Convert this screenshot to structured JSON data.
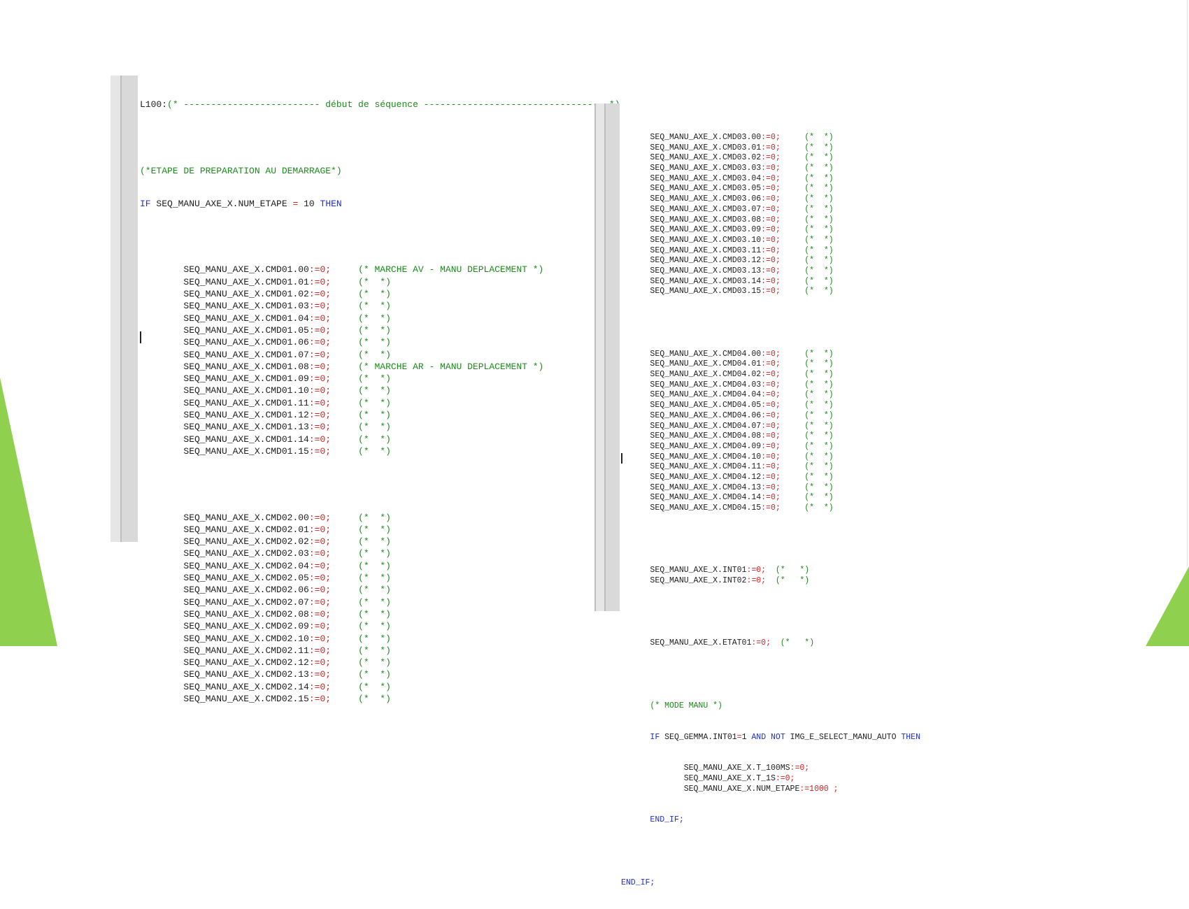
{
  "colors": {
    "background": "#ffffff",
    "keyword": "#1f2fd0",
    "operator": "#d42020",
    "comment": "#1e8a1e",
    "slide_accent": "#8fd14f"
  },
  "left_panel": {
    "header": {
      "label": "L100:",
      "comment": "(* ------------------------- début de séquence --------------------------------- *)"
    },
    "step_comment": "(*ETAPE DE PREPARATION AU DEMARRAGE*)",
    "if_line": {
      "kw_if": "IF",
      "condition": "SEQ_MANU_AXE_X.NUM_ETAPE",
      "op": "=",
      "value": "10",
      "kw_then": "THEN"
    },
    "group1": [
      {
        "var": "SEQ_MANU_AXE_X.CMD01.00",
        "assign": ":=0;",
        "comment": "(* MARCHE AV - MANU DEPLACEMENT *)"
      },
      {
        "var": "SEQ_MANU_AXE_X.CMD01.01",
        "assign": ":=0;",
        "comment": "(*  *)"
      },
      {
        "var": "SEQ_MANU_AXE_X.CMD01.02",
        "assign": ":=0;",
        "comment": "(*  *)"
      },
      {
        "var": "SEQ_MANU_AXE_X.CMD01.03",
        "assign": ":=0;",
        "comment": "(*  *)"
      },
      {
        "var": "SEQ_MANU_AXE_X.CMD01.04",
        "assign": ":=0;",
        "comment": "(*  *)"
      },
      {
        "var": "SEQ_MANU_AXE_X.CMD01.05",
        "assign": ":=0;",
        "comment": "(*  *)"
      },
      {
        "var": "SEQ_MANU_AXE_X.CMD01.06",
        "assign": ":=0;",
        "comment": "(*  *)"
      },
      {
        "var": "SEQ_MANU_AXE_X.CMD01.07",
        "assign": ":=0;",
        "comment": "(*  *)"
      },
      {
        "var": "SEQ_MANU_AXE_X.CMD01.08",
        "assign": ":=0;",
        "comment": "(* MARCHE AR - MANU DEPLACEMENT *)"
      },
      {
        "var": "SEQ_MANU_AXE_X.CMD01.09",
        "assign": ":=0;",
        "comment": "(*  *)"
      },
      {
        "var": "SEQ_MANU_AXE_X.CMD01.10",
        "assign": ":=0;",
        "comment": "(*  *)"
      },
      {
        "var": "SEQ_MANU_AXE_X.CMD01.11",
        "assign": ":=0;",
        "comment": "(*  *)"
      },
      {
        "var": "SEQ_MANU_AXE_X.CMD01.12",
        "assign": ":=0;",
        "comment": "(*  *)"
      },
      {
        "var": "SEQ_MANU_AXE_X.CMD01.13",
        "assign": ":=0;",
        "comment": "(*  *)"
      },
      {
        "var": "SEQ_MANU_AXE_X.CMD01.14",
        "assign": ":=0;",
        "comment": "(*  *)"
      },
      {
        "var": "SEQ_MANU_AXE_X.CMD01.15",
        "assign": ":=0;",
        "comment": "(*  *)"
      }
    ],
    "group2": [
      {
        "var": "SEQ_MANU_AXE_X.CMD02.00",
        "assign": ":=0;",
        "comment": "(*  *)"
      },
      {
        "var": "SEQ_MANU_AXE_X.CMD02.01",
        "assign": ":=0;",
        "comment": "(*  *)"
      },
      {
        "var": "SEQ_MANU_AXE_X.CMD02.02",
        "assign": ":=0;",
        "comment": "(*  *)"
      },
      {
        "var": "SEQ_MANU_AXE_X.CMD02.03",
        "assign": ":=0;",
        "comment": "(*  *)"
      },
      {
        "var": "SEQ_MANU_AXE_X.CMD02.04",
        "assign": ":=0;",
        "comment": "(*  *)"
      },
      {
        "var": "SEQ_MANU_AXE_X.CMD02.05",
        "assign": ":=0;",
        "comment": "(*  *)"
      },
      {
        "var": "SEQ_MANU_AXE_X.CMD02.06",
        "assign": ":=0;",
        "comment": "(*  *)"
      },
      {
        "var": "SEQ_MANU_AXE_X.CMD02.07",
        "assign": ":=0;",
        "comment": "(*  *)"
      },
      {
        "var": "SEQ_MANU_AXE_X.CMD02.08",
        "assign": ":=0;",
        "comment": "(*  *)"
      },
      {
        "var": "SEQ_MANU_AXE_X.CMD02.09",
        "assign": ":=0;",
        "comment": "(*  *)"
      },
      {
        "var": "SEQ_MANU_AXE_X.CMD02.10",
        "assign": ":=0;",
        "comment": "(*  *)"
      },
      {
        "var": "SEQ_MANU_AXE_X.CMD02.11",
        "assign": ":=0;",
        "comment": "(*  *)"
      },
      {
        "var": "SEQ_MANU_AXE_X.CMD02.12",
        "assign": ":=0;",
        "comment": "(*  *)"
      },
      {
        "var": "SEQ_MANU_AXE_X.CMD02.13",
        "assign": ":=0;",
        "comment": "(*  *)"
      },
      {
        "var": "SEQ_MANU_AXE_X.CMD02.14",
        "assign": ":=0;",
        "comment": "(*  *)"
      },
      {
        "var": "SEQ_MANU_AXE_X.CMD02.15",
        "assign": ":=0;",
        "comment": "(*  *)"
      }
    ]
  },
  "right_panel": {
    "group3": [
      {
        "var": "SEQ_MANU_AXE_X.CMD03.00",
        "assign": ":=0;",
        "comment": "(*  *)"
      },
      {
        "var": "SEQ_MANU_AXE_X.CMD03.01",
        "assign": ":=0;",
        "comment": "(*  *)"
      },
      {
        "var": "SEQ_MANU_AXE_X.CMD03.02",
        "assign": ":=0;",
        "comment": "(*  *)"
      },
      {
        "var": "SEQ_MANU_AXE_X.CMD03.03",
        "assign": ":=0;",
        "comment": "(*  *)"
      },
      {
        "var": "SEQ_MANU_AXE_X.CMD03.04",
        "assign": ":=0;",
        "comment": "(*  *)"
      },
      {
        "var": "SEQ_MANU_AXE_X.CMD03.05",
        "assign": ":=0;",
        "comment": "(*  *)"
      },
      {
        "var": "SEQ_MANU_AXE_X.CMD03.06",
        "assign": ":=0;",
        "comment": "(*  *)"
      },
      {
        "var": "SEQ_MANU_AXE_X.CMD03.07",
        "assign": ":=0;",
        "comment": "(*  *)"
      },
      {
        "var": "SEQ_MANU_AXE_X.CMD03.08",
        "assign": ":=0;",
        "comment": "(*  *)"
      },
      {
        "var": "SEQ_MANU_AXE_X.CMD03.09",
        "assign": ":=0;",
        "comment": "(*  *)"
      },
      {
        "var": "SEQ_MANU_AXE_X.CMD03.10",
        "assign": ":=0;",
        "comment": "(*  *)"
      },
      {
        "var": "SEQ_MANU_AXE_X.CMD03.11",
        "assign": ":=0;",
        "comment": "(*  *)"
      },
      {
        "var": "SEQ_MANU_AXE_X.CMD03.12",
        "assign": ":=0;",
        "comment": "(*  *)"
      },
      {
        "var": "SEQ_MANU_AXE_X.CMD03.13",
        "assign": ":=0;",
        "comment": "(*  *)"
      },
      {
        "var": "SEQ_MANU_AXE_X.CMD03.14",
        "assign": ":=0;",
        "comment": "(*  *)"
      },
      {
        "var": "SEQ_MANU_AXE_X.CMD03.15",
        "assign": ":=0;",
        "comment": "(*  *)"
      }
    ],
    "group4": [
      {
        "var": "SEQ_MANU_AXE_X.CMD04.00",
        "assign": ":=0;",
        "comment": "(*  *)"
      },
      {
        "var": "SEQ_MANU_AXE_X.CMD04.01",
        "assign": ":=0;",
        "comment": "(*  *)"
      },
      {
        "var": "SEQ_MANU_AXE_X.CMD04.02",
        "assign": ":=0;",
        "comment": "(*  *)"
      },
      {
        "var": "SEQ_MANU_AXE_X.CMD04.03",
        "assign": ":=0;",
        "comment": "(*  *)"
      },
      {
        "var": "SEQ_MANU_AXE_X.CMD04.04",
        "assign": ":=0;",
        "comment": "(*  *)"
      },
      {
        "var": "SEQ_MANU_AXE_X.CMD04.05",
        "assign": ":=0;",
        "comment": "(*  *)"
      },
      {
        "var": "SEQ_MANU_AXE_X.CMD04.06",
        "assign": ":=0;",
        "comment": "(*  *)"
      },
      {
        "var": "SEQ_MANU_AXE_X.CMD04.07",
        "assign": ":=0;",
        "comment": "(*  *)"
      },
      {
        "var": "SEQ_MANU_AXE_X.CMD04.08",
        "assign": ":=0;",
        "comment": "(*  *)"
      },
      {
        "var": "SEQ_MANU_AXE_X.CMD04.09",
        "assign": ":=0;",
        "comment": "(*  *)"
      },
      {
        "var": "SEQ_MANU_AXE_X.CMD04.10",
        "assign": ":=0;",
        "comment": "(*  *)"
      },
      {
        "var": "SEQ_MANU_AXE_X.CMD04.11",
        "assign": ":=0;",
        "comment": "(*  *)"
      },
      {
        "var": "SEQ_MANU_AXE_X.CMD04.12",
        "assign": ":=0;",
        "comment": "(*  *)"
      },
      {
        "var": "SEQ_MANU_AXE_X.CMD04.13",
        "assign": ":=0;",
        "comment": "(*  *)"
      },
      {
        "var": "SEQ_MANU_AXE_X.CMD04.14",
        "assign": ":=0;",
        "comment": "(*  *)"
      },
      {
        "var": "SEQ_MANU_AXE_X.CMD04.15",
        "assign": ":=0;",
        "comment": "(*  *)"
      }
    ],
    "group5": [
      {
        "var": "SEQ_MANU_AXE_X.INT01",
        "assign": ":=0;",
        "comment": "(*   *)"
      },
      {
        "var": "SEQ_MANU_AXE_X.INT02",
        "assign": ":=0;",
        "comment": "(*   *)"
      }
    ],
    "etat_line": {
      "var": "SEQ_MANU_AXE_X.ETAT01",
      "assign": ":=0;",
      "comment": "(*   *)"
    },
    "mode_comment": "(* MODE MANU *)",
    "if2": {
      "kw_if": "IF",
      "cond1": "SEQ_GEMMA.INT01",
      "op1": "=",
      "val1": "1",
      "kw_and": "AND",
      "kw_not": "NOT",
      "cond2": "IMG_E_SELECT_MANU_AUTO",
      "kw_then": "THEN"
    },
    "inner": [
      {
        "var": "SEQ_MANU_AXE_X.T_100MS",
        "assign": ":=0;"
      },
      {
        "var": "SEQ_MANU_AXE_X.T_1S",
        "assign": ":=0;"
      },
      {
        "var": "SEQ_MANU_AXE_X.NUM_ETAPE",
        "assign": ":=1000 ;"
      }
    ],
    "end_if_inner": "END_IF;",
    "end_if_outer": "END_IF;"
  }
}
